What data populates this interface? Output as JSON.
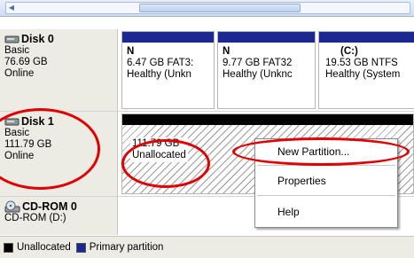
{
  "disks": [
    {
      "name": "Disk 0",
      "type": "Basic",
      "size": "76.69 GB",
      "status": "Online",
      "partitions": [
        {
          "name": "N",
          "detail": "6.47 GB FAT3:",
          "health": "Healthy (Unkn"
        },
        {
          "name": "N",
          "detail": "9.77 GB FAT32",
          "health": "Healthy (Unknc"
        },
        {
          "name": "(C:)",
          "detail": "19.53 GB NTFS",
          "health": "Healthy (System"
        }
      ]
    },
    {
      "name": "Disk 1",
      "type": "Basic",
      "size": "111.79 GB",
      "status": "Online",
      "unallocated": {
        "size": "111.79 GB",
        "label": "Unallocated"
      }
    }
  ],
  "cdrom": {
    "name": "CD-ROM 0",
    "drive": "CD-ROM (D:)"
  },
  "legend": {
    "unallocated": "Unallocated",
    "primary": "Primary partition",
    "unallocated_color": "#000000",
    "primary_color": "#1c2891"
  },
  "context_menu": {
    "items": [
      "New Partition...",
      "Properties",
      "Help"
    ]
  },
  "icons": {
    "disk": "hard-disk-icon",
    "cdrom": "cd-rom-icon"
  },
  "highlight_color": "#e00000"
}
